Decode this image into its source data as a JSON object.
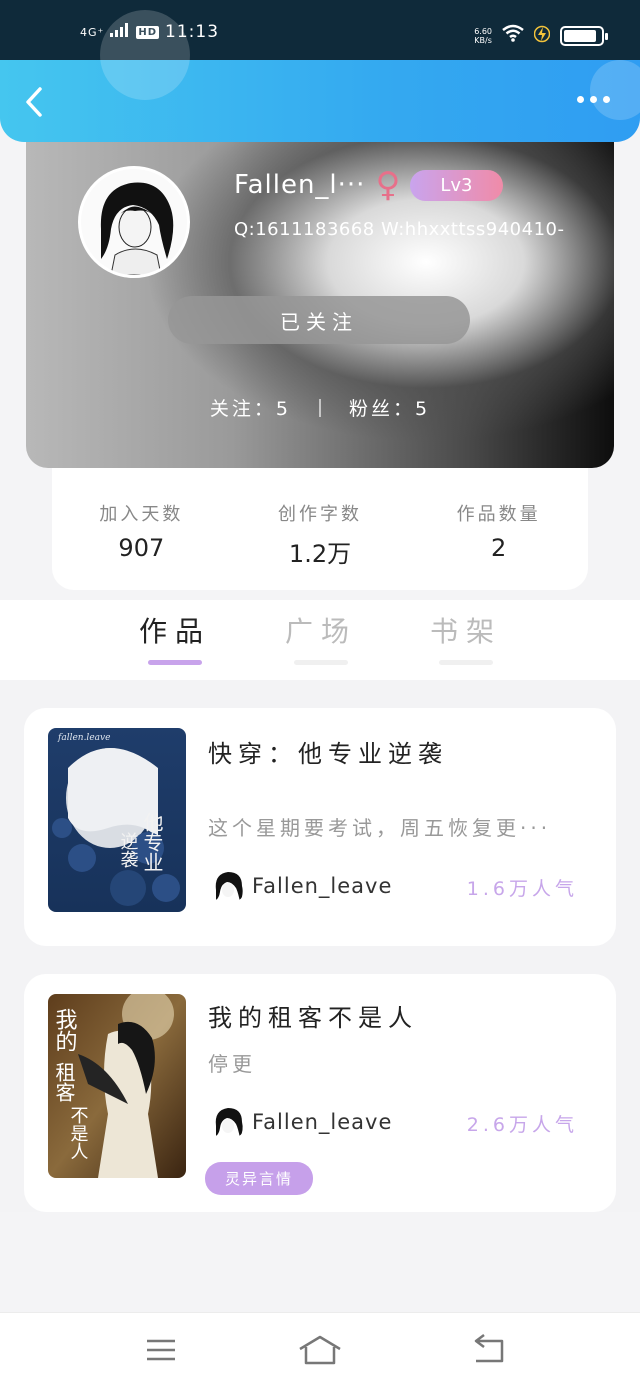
{
  "status_bar": {
    "network": "4G⁺",
    "hd": "HD",
    "time": "11:13",
    "speed_value": "6.60",
    "speed_unit": "KB/s",
    "battery_percent": 90
  },
  "header": {
    "back": "back-icon",
    "more": "more-icon"
  },
  "profile": {
    "username": "Fallen_l···",
    "gender_symbol": "♀",
    "level": "Lv3",
    "contact": "Q:1611183668 W:hhxxttss940410-",
    "follow_label": "已关注",
    "following": "关注：5",
    "fans": "粉丝：5"
  },
  "stats": [
    {
      "label": "加入天数",
      "value": "907"
    },
    {
      "label": "创作字数",
      "value": "1.2万"
    },
    {
      "label": "作品数量",
      "value": "2"
    }
  ],
  "tabs": [
    {
      "label": "作品",
      "active": true
    },
    {
      "label": "广场",
      "active": false
    },
    {
      "label": "书架",
      "active": false
    }
  ],
  "books": [
    {
      "title": "快穿：他专业逆袭",
      "description": "这个星期要考试，周五恢复更···",
      "author": "Fallen_leave",
      "popularity": "1.6万人气",
      "cover_text_top": "fallen.leave",
      "cover_title": "他专业逆袭"
    },
    {
      "title": "我的租客不是人",
      "description": "停更",
      "author": "Fallen_leave",
      "popularity": "2.6万人气",
      "tag": "灵异言情",
      "cover_title": "我的租客不是人"
    }
  ],
  "nav": {
    "menu": "menu-icon",
    "home": "home-icon",
    "back": "back-nav-icon"
  },
  "colors": {
    "header_blue": "#34a9f0",
    "accent_purple": "#c8a3eb",
    "female_pink": "#e7708a"
  }
}
